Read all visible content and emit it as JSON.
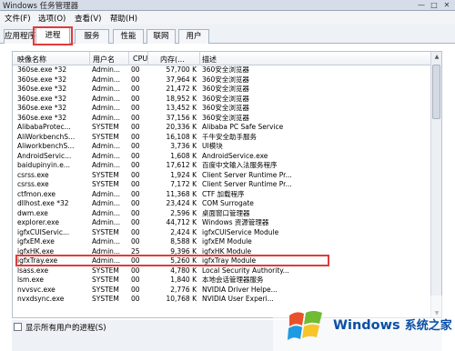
{
  "window": {
    "title": "Windows 任务管理器",
    "buttons": [
      "—",
      "□",
      "✕"
    ]
  },
  "menu": [
    "文件(F)",
    "选项(O)",
    "查看(V)",
    "帮助(H)"
  ],
  "tabs": [
    "应用程序",
    "进程",
    "服务",
    "性能",
    "联网",
    "用户"
  ],
  "active_tab": "进程",
  "columns": [
    "映像名称",
    "用户名",
    "CPU",
    "内存(...",
    "描述"
  ],
  "rows": [
    {
      "name": "360se.exe *32",
      "user": "Admin...",
      "cpu": "00",
      "mem": "57,700 K",
      "desc": "360安全浏览器"
    },
    {
      "name": "360se.exe *32",
      "user": "Admin...",
      "cpu": "00",
      "mem": "37,964 K",
      "desc": "360安全浏览器"
    },
    {
      "name": "360se.exe *32",
      "user": "Admin...",
      "cpu": "00",
      "mem": "21,472 K",
      "desc": "360安全浏览器"
    },
    {
      "name": "360se.exe *32",
      "user": "Admin...",
      "cpu": "00",
      "mem": "18,952 K",
      "desc": "360安全浏览器"
    },
    {
      "name": "360se.exe *32",
      "user": "Admin...",
      "cpu": "00",
      "mem": "13,452 K",
      "desc": "360安全浏览器"
    },
    {
      "name": "360se.exe *32",
      "user": "Admin...",
      "cpu": "00",
      "mem": "37,156 K",
      "desc": "360安全浏览器"
    },
    {
      "name": "AlibabaProtec...",
      "user": "SYSTEM",
      "cpu": "00",
      "mem": "20,336 K",
      "desc": "Alibaba PC Safe Service"
    },
    {
      "name": "AliWorkbenchS...",
      "user": "SYSTEM",
      "cpu": "00",
      "mem": "16,108 K",
      "desc": "千牛安全助手服务"
    },
    {
      "name": "AliworkbenchS...",
      "user": "Admin...",
      "cpu": "00",
      "mem": "3,736 K",
      "desc": "UI模块"
    },
    {
      "name": "AndroidServic...",
      "user": "Admin...",
      "cpu": "00",
      "mem": "1,608 K",
      "desc": "AndroidService.exe"
    },
    {
      "name": "baidupinyin.e...",
      "user": "Admin...",
      "cpu": "00",
      "mem": "17,612 K",
      "desc": "百度中文输入法服务程序"
    },
    {
      "name": "csrss.exe",
      "user": "SYSTEM",
      "cpu": "00",
      "mem": "1,924 K",
      "desc": "Client Server Runtime Pr..."
    },
    {
      "name": "csrss.exe",
      "user": "SYSTEM",
      "cpu": "00",
      "mem": "7,172 K",
      "desc": "Client Server Runtime Pr..."
    },
    {
      "name": "ctfmon.exe",
      "user": "Admin...",
      "cpu": "00",
      "mem": "11,368 K",
      "desc": "CTF 加载程序"
    },
    {
      "name": "dllhost.exe *32",
      "user": "Admin...",
      "cpu": "00",
      "mem": "23,424 K",
      "desc": "COM Surrogate"
    },
    {
      "name": "dwm.exe",
      "user": "Admin...",
      "cpu": "00",
      "mem": "2,596 K",
      "desc": "桌面窗口管理器"
    },
    {
      "name": "explorer.exe",
      "user": "Admin...",
      "cpu": "00",
      "mem": "44,712 K",
      "desc": "Windows 资源管理器"
    },
    {
      "name": "igfxCUIServic...",
      "user": "SYSTEM",
      "cpu": "00",
      "mem": "2,424 K",
      "desc": "igfxCUIService Module"
    },
    {
      "name": "igfxEM.exe",
      "user": "Admin...",
      "cpu": "00",
      "mem": "8,588 K",
      "desc": "igfxEM Module"
    },
    {
      "name": "igfxHK.exe",
      "user": "Admin...",
      "cpu": "25",
      "mem": "9,396 K",
      "desc": "igfxHK Module"
    },
    {
      "name": "igfxTray.exe",
      "user": "Admin...",
      "cpu": "00",
      "mem": "5,260 K",
      "desc": "igfxTray Module"
    },
    {
      "name": "lsass.exe",
      "user": "SYSTEM",
      "cpu": "00",
      "mem": "4,780 K",
      "desc": "Local Security Authority..."
    },
    {
      "name": "lsm.exe",
      "user": "SYSTEM",
      "cpu": "00",
      "mem": "1,840 K",
      "desc": "本地会话管理器服务"
    },
    {
      "name": "nvvsvc.exe",
      "user": "SYSTEM",
      "cpu": "00",
      "mem": "2,776 K",
      "desc": "NVIDIA Driver Helpe..."
    },
    {
      "name": "nvxdsync.exe",
      "user": "SYSTEM",
      "cpu": "00",
      "mem": "10,768 K",
      "desc": "NVIDIA User Experi..."
    }
  ],
  "show_all_processes": "显示所有用户的进程(S)",
  "watermark": {
    "brand": "Windows",
    "sub": "系统之家"
  }
}
